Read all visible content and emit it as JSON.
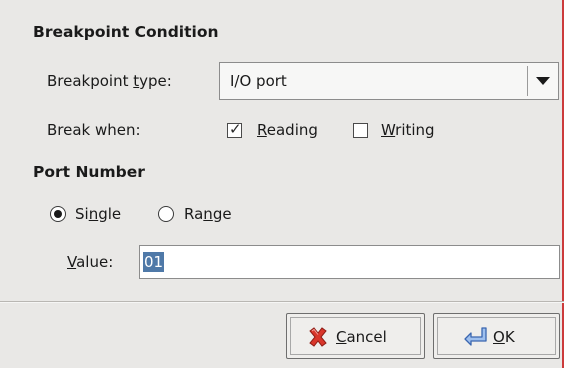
{
  "dialog": {
    "breakpoint_condition_title": "Breakpoint Condition",
    "breakpoint_type": {
      "label_pre": "Breakpoint ",
      "label_mnemonic": "t",
      "label_post": "ype:",
      "selected_value": "I/O port"
    },
    "break_when": {
      "label": "Break when:",
      "reading": {
        "mnemonic": "R",
        "rest": "eading",
        "checked": true
      },
      "writing": {
        "mnemonic": "W",
        "rest": "riting",
        "checked": false
      }
    },
    "port_number_title": "Port Number",
    "port_mode": {
      "single": {
        "pre": "Si",
        "mnemonic": "n",
        "post": "gle",
        "selected": true
      },
      "range": {
        "pre": "Ra",
        "mnemonic": "n",
        "post": "ge",
        "selected": false
      }
    },
    "value": {
      "mnemonic": "V",
      "rest": "alue:",
      "current_value": "01"
    },
    "buttons": {
      "cancel": {
        "mnemonic": "C",
        "rest": "ancel"
      },
      "ok": {
        "mnemonic": "O",
        "rest": "K"
      }
    }
  },
  "colors": {
    "dialog_bg": "#e9e8e6",
    "selection": "#4f79a8",
    "cancel_icon": "#d9362b",
    "ok_icon": "#4a7fd0",
    "window_edge": "#cc3b3b"
  },
  "icons": {
    "cancel": "red-x-icon",
    "ok": "blue-return-arrow-icon"
  }
}
